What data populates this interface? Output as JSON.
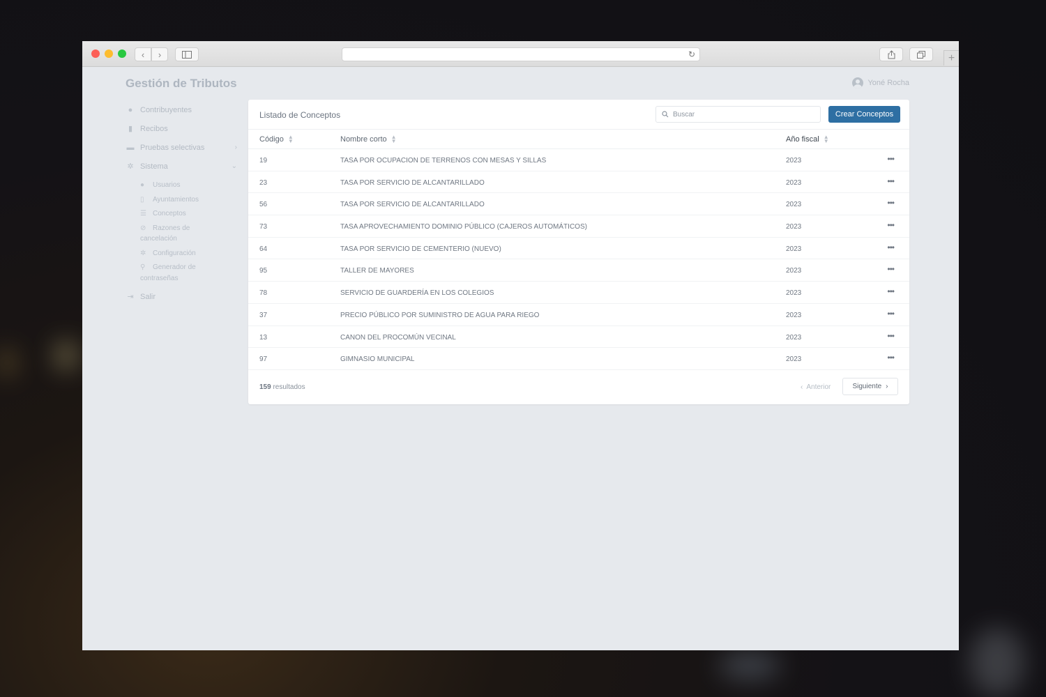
{
  "app": {
    "title": "Gestión de Tributos",
    "user_name": "Yoné Rocha"
  },
  "sidebar": {
    "items": [
      {
        "label": "Contribuyentes",
        "icon": "user-icon"
      },
      {
        "label": "Recibos",
        "icon": "document-icon"
      },
      {
        "label": "Pruebas selectivas",
        "icon": "graduation-cap-icon"
      },
      {
        "label": "Sistema",
        "icon": "gear-icon"
      }
    ],
    "sub_items": [
      {
        "label": "Usuarios",
        "icon": "user-icon"
      },
      {
        "label": "Ayuntamientos",
        "icon": "building-icon"
      },
      {
        "label": "Conceptos",
        "icon": "list-icon"
      },
      {
        "label": "Razones de cancelación",
        "icon": "ban-icon"
      },
      {
        "label": "Configuración",
        "icon": "gear-icon"
      },
      {
        "label": "Generador de contraseñas",
        "icon": "wrench-icon"
      }
    ],
    "logout": {
      "label": "Salir",
      "icon": "sign-out-icon"
    }
  },
  "card": {
    "title": "Listado de Conceptos",
    "search_placeholder": "Buscar",
    "create_label": "Crear Conceptos",
    "columns": {
      "code": "Código",
      "name": "Nombre corto",
      "year": "Año fiscal"
    },
    "rows": [
      {
        "code": "19",
        "name": "TASA POR OCUPACION DE TERRENOS CON MESAS Y SILLAS",
        "year": "2023"
      },
      {
        "code": "23",
        "name": "TASA POR SERVICIO DE ALCANTARILLADO",
        "year": "2023"
      },
      {
        "code": "56",
        "name": "TASA POR SERVICIO DE ALCANTARILLADO",
        "year": "2023"
      },
      {
        "code": "73",
        "name": "TASA APROVECHAMIENTO DOMINIO PÚBLICO (CAJEROS AUTOMÁTICOS)",
        "year": "2023"
      },
      {
        "code": "64",
        "name": "TASA POR SERVICIO DE CEMENTERIO (NUEVO)",
        "year": "2023"
      },
      {
        "code": "95",
        "name": "TALLER DE MAYORES",
        "year": "2023"
      },
      {
        "code": "78",
        "name": "SERVICIO DE GUARDERÍA EN LOS COLEGIOS",
        "year": "2023"
      },
      {
        "code": "37",
        "name": "PRECIO PÚBLICO POR SUMINISTRO DE AGUA PARA RIEGO",
        "year": "2023"
      },
      {
        "code": "13",
        "name": "CANON DEL PROCOMÚN VECINAL",
        "year": "2023"
      },
      {
        "code": "97",
        "name": "GIMNASIO MUNICIPAL",
        "year": "2023"
      }
    ],
    "results_count": "159",
    "results_label": "resultados",
    "prev_label": "Anterior",
    "next_label": "Siguiente"
  },
  "colors": {
    "primary": "#2e6fa3",
    "background": "#e6e9ed"
  }
}
